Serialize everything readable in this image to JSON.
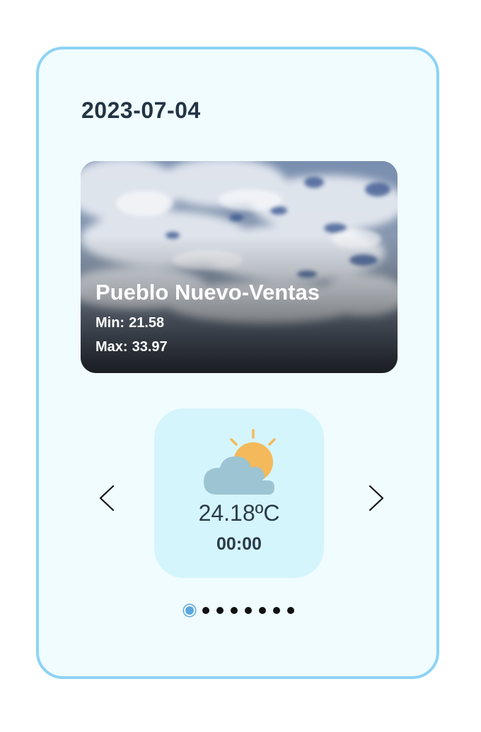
{
  "date": "2023-07-04",
  "location": {
    "city": "Pueblo Nuevo-Ventas",
    "min_label": "Min:",
    "min_value": "21.58",
    "max_label": "Max:",
    "max_value": "33.97"
  },
  "forecast": {
    "icon": "partly-cloudy-icon",
    "temperature": "24.18ºC",
    "time": "00:00"
  },
  "carousel": {
    "total_pages": 8,
    "active_page": 1
  },
  "colors": {
    "card_border": "#8fd3f4",
    "card_background": "#f0fcff",
    "forecast_background": "#d5f5fd",
    "active_dot": "#5aa8e0",
    "sun": "#f4b95a",
    "cloud": "#9dc4d2"
  }
}
